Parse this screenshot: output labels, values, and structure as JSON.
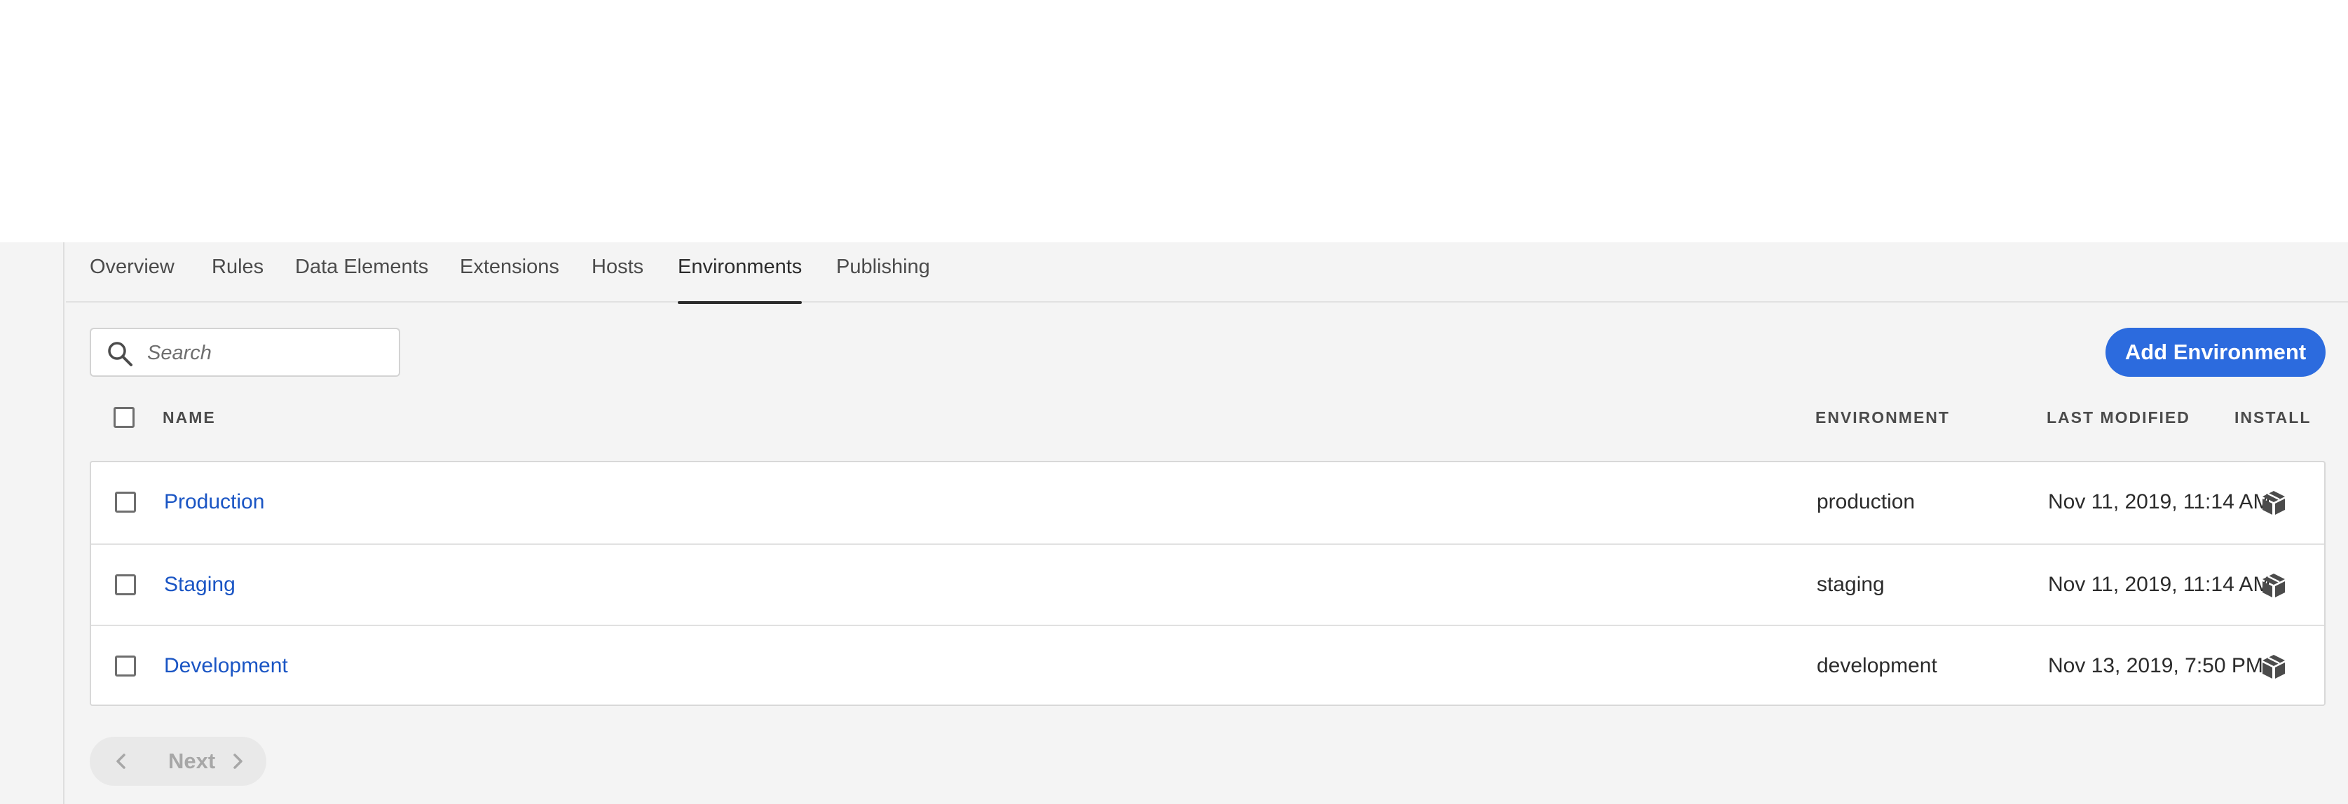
{
  "tabs": [
    {
      "label": "Overview"
    },
    {
      "label": "Rules"
    },
    {
      "label": "Data Elements"
    },
    {
      "label": "Extensions"
    },
    {
      "label": "Hosts"
    },
    {
      "label": "Environments",
      "active": true
    },
    {
      "label": "Publishing"
    }
  ],
  "search": {
    "placeholder": "Search",
    "value": "",
    "icon": "search-icon"
  },
  "add_button": {
    "label": "Add Environment",
    "color": "#2c6bde"
  },
  "table": {
    "columns": [
      "NAME",
      "ENVIRONMENT",
      "LAST MODIFIED",
      "INSTALL"
    ],
    "rows": [
      {
        "name": "Production",
        "environment": "production",
        "last_modified": "Nov 11, 2019, 11:14 AM",
        "install_icon": "package-icon"
      },
      {
        "name": "Staging",
        "environment": "staging",
        "last_modified": "Nov 11, 2019, 11:14 AM",
        "install_icon": "package-icon"
      },
      {
        "name": "Development",
        "environment": "development",
        "last_modified": "Nov 13, 2019, 7:50 PM",
        "install_icon": "package-icon"
      }
    ]
  },
  "pagination": {
    "next_label": "Next",
    "prev_icon": "chevron-left-icon",
    "next_icon": "chevron-right-icon"
  },
  "colors": {
    "link": "#1a55c4",
    "accent": "#2c6bde",
    "background": "#f4f4f4"
  }
}
